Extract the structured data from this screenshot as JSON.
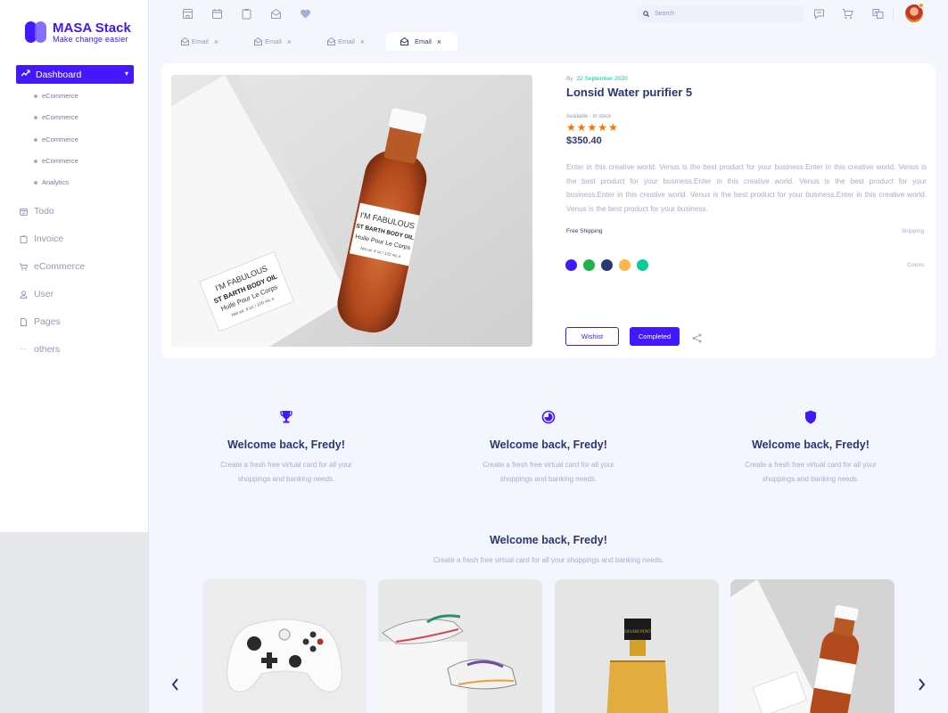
{
  "brand": {
    "title": "MASA Stack",
    "subtitle": "Make change easier",
    "color": "#4318ff"
  },
  "sidebar": {
    "active": {
      "label": "Dashboard",
      "icon": "trend-icon"
    },
    "sub_items": [
      {
        "label": "eCommerce"
      },
      {
        "label": "eCommerce"
      },
      {
        "label": "eCommerce"
      },
      {
        "label": "eCommerce"
      },
      {
        "label": "Analytics"
      }
    ],
    "items": [
      {
        "label": "Todo",
        "icon": "calendar-icon"
      },
      {
        "label": "Invoice",
        "icon": "clipboard-icon"
      },
      {
        "label": "eCommerce",
        "icon": "cart-icon"
      },
      {
        "label": "User",
        "icon": "user-icon"
      },
      {
        "label": "Pages",
        "icon": "file-icon"
      },
      {
        "label": "others",
        "icon": "dots-icon"
      }
    ]
  },
  "topbar": {
    "icons": [
      "store-icon",
      "calendar-icon",
      "clipboard-icon",
      "mail-icon",
      "heart-icon"
    ],
    "search_placeholder": "Search",
    "right_icons": [
      "chat-icon",
      "cart-icon",
      "translate-icon"
    ]
  },
  "tabs": [
    {
      "label": "Email",
      "active": false
    },
    {
      "label": "Email",
      "active": false
    },
    {
      "label": "Email",
      "active": false
    },
    {
      "label": "Email",
      "active": true
    }
  ],
  "product": {
    "by": "By",
    "date": "22 September 2020",
    "title": "Lonsid Water purifier 5",
    "availability": "Available - In stock",
    "rating": 5,
    "price": "$350.40",
    "description": "Enter in this creative world. Venus is the best product for your business.Enter in this creative world. Venus is the best product for your business.Enter in this creative world. Venus is the best product for your business.Enter in this creative world. Venus is the best product for your business.Enter in this creative world. Venus is the best product for your business.",
    "shipping_label": "Free Shipping",
    "shipping_right": "Shipping",
    "colors_label": "Colors",
    "colors": [
      "#4318ff",
      "#1eb44a",
      "#2b3674",
      "#ffb547",
      "#05cd99"
    ],
    "wishlist_label": "Wishist",
    "completed_label": "Completed",
    "image_label": {
      "line1": "I'M FABULOUS",
      "line2": "ST BARTH BODY OIL",
      "line3": "Huile Pour Le Corps",
      "line4": "Net wt. 4 oz / 120 mL e"
    }
  },
  "features": [
    {
      "icon": "trophy-icon",
      "title": "Welcome back, Fredy!",
      "text": "Create a fresh free virtual card for all your shoppings and banking needs."
    },
    {
      "icon": "pie-icon",
      "title": "Welcome back, Fredy!",
      "text": "Create a fresh free virtual card for all your shoppings and banking needs."
    },
    {
      "icon": "shield-icon",
      "title": "Welcome back, Fredy!",
      "text": "Create a fresh free virtual card for all your shoppings and banking needs."
    }
  ],
  "gallery": {
    "title": "Welcome back, Fredy!",
    "subtitle": "Create a fresh free virtual card for all your shoppings and banking needs.",
    "bottle_brand": "DISARONNO",
    "items": [
      "controller-photo",
      "sneakers-photo",
      "liqueur-photo",
      "body-oil-photo"
    ]
  }
}
